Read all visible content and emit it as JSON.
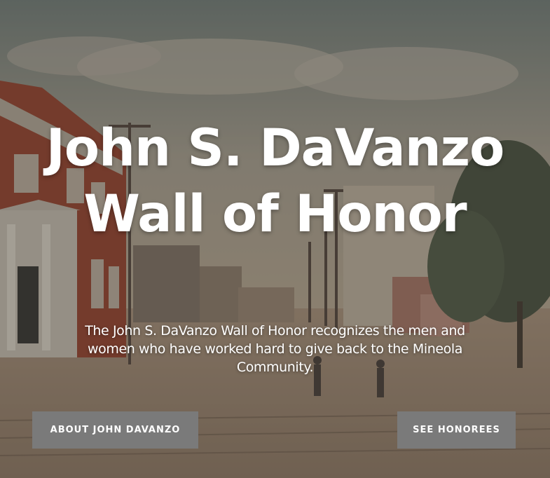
{
  "hero": {
    "title": "John S. DaVanzo Wall of Honor",
    "subtitle": "The John S. DaVanzo Wall of Honor recognizes the men and women who have worked hard to give back to the Mineola Community.",
    "background_image": "vintage-street-postcard",
    "buttons": {
      "about_label": "ABOUT JOHN DAVANZO",
      "honorees_label": "SEE HONOREES"
    },
    "colors": {
      "button_bg": "#7a7a7a",
      "text": "#ffffff"
    }
  }
}
